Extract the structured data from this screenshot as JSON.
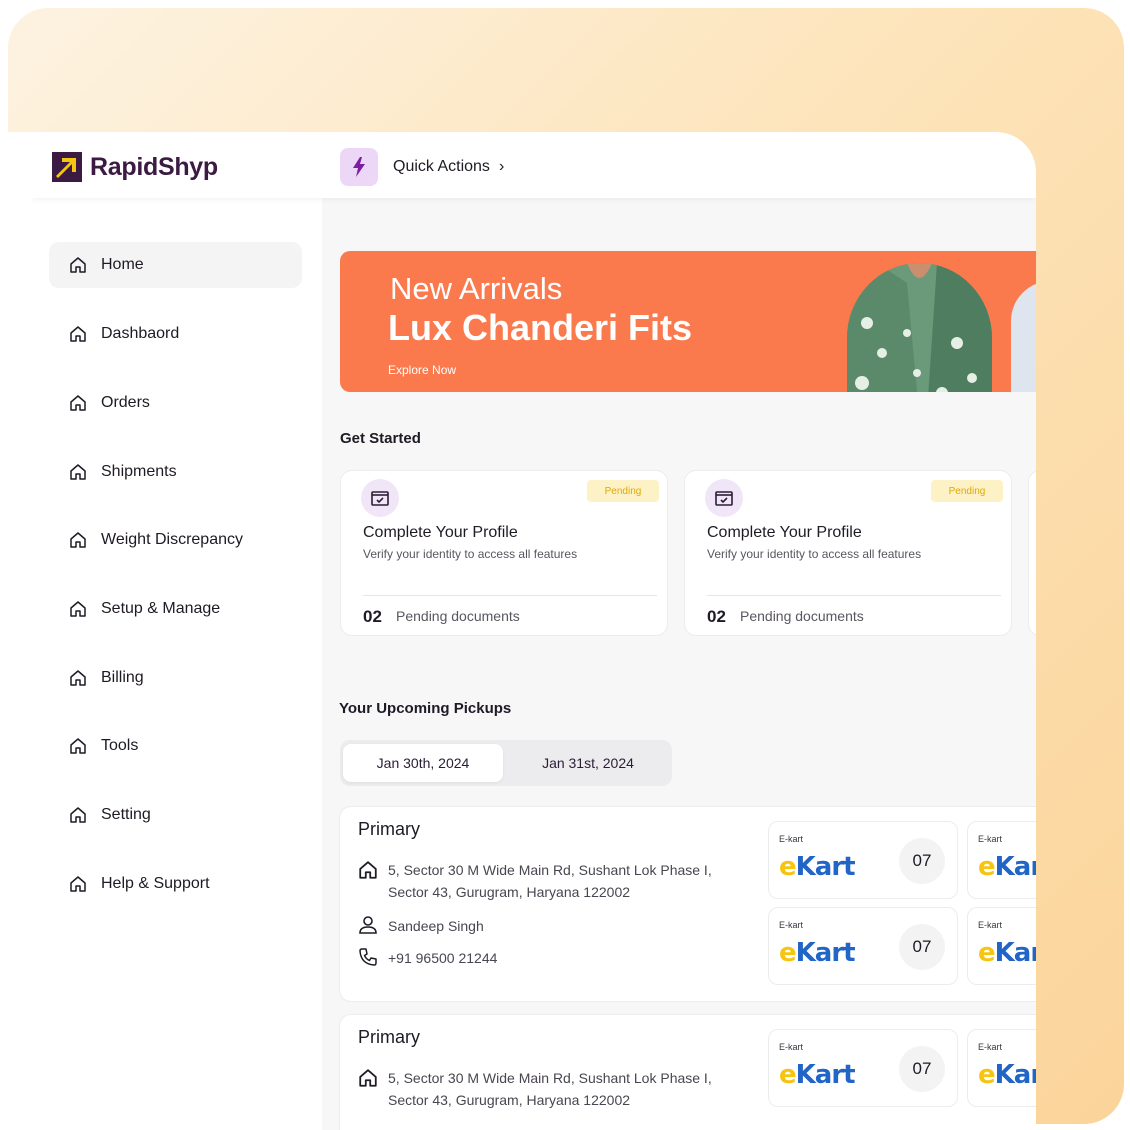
{
  "brand": {
    "name": "RapidShyp"
  },
  "quick_actions": {
    "label": "Quick Actions",
    "chevron": "›",
    "icon": "lightning-icon"
  },
  "sidebar": {
    "items": [
      {
        "label": "Home",
        "icon": "home-icon",
        "active": true
      },
      {
        "label": "Dashbaord",
        "icon": "home-icon"
      },
      {
        "label": "Orders",
        "icon": "home-icon"
      },
      {
        "label": "Shipments",
        "icon": "home-icon"
      },
      {
        "label": "Weight Discrepancy",
        "icon": "home-icon"
      },
      {
        "label": "Setup & Manage",
        "icon": "home-icon"
      },
      {
        "label": "Billing",
        "icon": "home-icon"
      },
      {
        "label": "Tools",
        "icon": "home-icon"
      },
      {
        "label": "Setting",
        "icon": "home-icon"
      },
      {
        "label": "Help & Support",
        "icon": "home-icon"
      }
    ]
  },
  "banner": {
    "line1": "New Arrivals",
    "line2": "Lux Chanderi Fits",
    "cta": "Explore Now",
    "color": "#fb7a4d"
  },
  "get_started": {
    "title": "Get Started",
    "cards": [
      {
        "badge": "Pending",
        "title": "Complete Your Profile",
        "subtitle": "Verify your identity  to access all  features",
        "count": "02",
        "count_label": "Pending documents",
        "icon": "calendar-check-icon"
      },
      {
        "badge": "Pending",
        "title": "Complete Your Profile",
        "subtitle": "Verify your identity  to access all  features",
        "count": "02",
        "count_label": "Pending documents",
        "icon": "calendar-check-icon"
      }
    ]
  },
  "pickups": {
    "title": "Your Upcoming Pickups",
    "tabs": [
      {
        "label": "Jan 30th, 2024",
        "active": true
      },
      {
        "label": "Jan 31st, 2024"
      }
    ],
    "items": [
      {
        "name": "Primary",
        "address_line1": "5, Sector 30 M Wide Main Rd, Sushant Lok Phase I,",
        "address_line2": "Sector 43, Gurugram, Haryana 122002",
        "contact": "Sandeep Singh",
        "phone": "+91 96500 21244",
        "carriers": [
          {
            "label": "E-kart",
            "logo": "ekart",
            "count": "07"
          },
          {
            "label": "E-kart",
            "logo": "ekar",
            "count": ""
          },
          {
            "label": "E-kart",
            "logo": "ekart",
            "count": "07"
          },
          {
            "label": "E-kart",
            "logo": "ekar",
            "count": ""
          }
        ]
      },
      {
        "name": "Primary",
        "address_line1": "5, Sector 30 M Wide Main Rd, Sushant Lok Phase I,",
        "address_line2": "Sector 43, Gurugram, Haryana 122002",
        "carriers": [
          {
            "label": "E-kart",
            "logo": "ekart",
            "count": "07"
          },
          {
            "label": "E-kart",
            "logo": "ekar",
            "count": ""
          }
        ]
      }
    ]
  },
  "colors": {
    "brand": "#3b1b42",
    "accent": "#fb7a4d",
    "pending": "#e0a800",
    "carrier_blue": "#2165c6",
    "carrier_yellow": "#f6c511"
  }
}
